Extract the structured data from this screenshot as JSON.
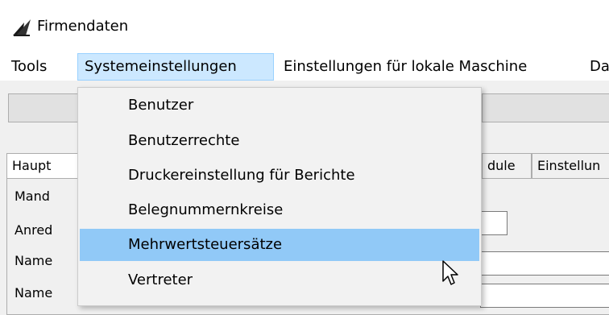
{
  "window": {
    "title": "Firmendaten",
    "icon": "app-logo-icon"
  },
  "menubar": {
    "items": [
      {
        "label": "Tools"
      },
      {
        "label": "Systemeinstellungen",
        "active": true
      },
      {
        "label": "Einstellungen für lokale Maschine"
      },
      {
        "label": "Da"
      }
    ]
  },
  "tabs": [
    {
      "label": "Haupt"
    },
    {
      "label": "dule"
    },
    {
      "label": "Einstellun"
    }
  ],
  "form": {
    "labels": [
      "Mand",
      "Anred",
      "Name",
      "Name"
    ]
  },
  "dropdown": {
    "items": [
      {
        "label": "Benutzer"
      },
      {
        "label": "Benutzerrechte"
      },
      {
        "label": "Druckereinstellung für Berichte"
      },
      {
        "label": "Belegnummernkreise"
      },
      {
        "label": "Mehrwertsteuersätze",
        "highlighted": true
      },
      {
        "label": "Vertreter"
      }
    ]
  },
  "colors": {
    "highlight": "#91c9f7",
    "menu_active_bg": "#cce8ff",
    "menu_active_border": "#99d1ff"
  }
}
